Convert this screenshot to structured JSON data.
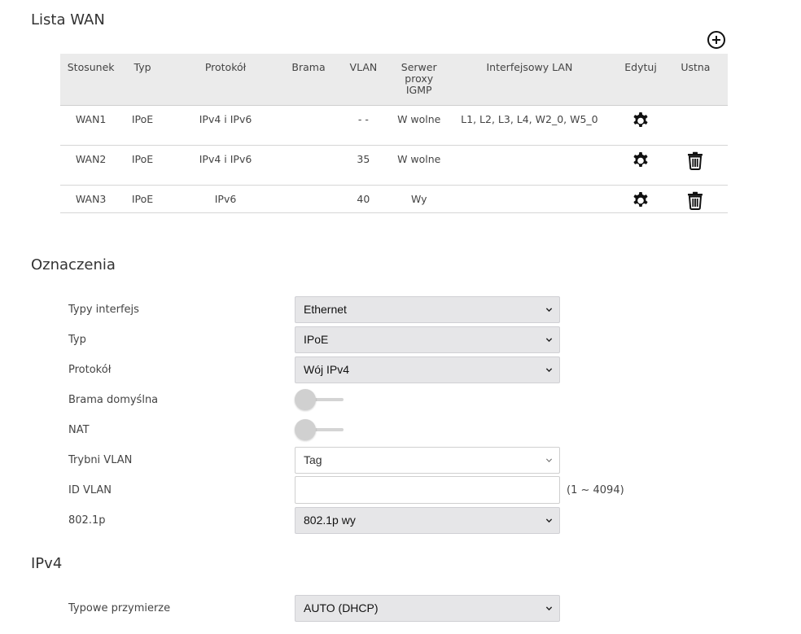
{
  "wan_list": {
    "title": "Lista WAN",
    "headers": [
      "Stosunek",
      "Typ",
      "Protokół",
      "Brama",
      "VLAN",
      "Serwer proxy IGMP",
      "Interfejsowy LAN",
      "Edytuj",
      "Ustna"
    ],
    "rows": [
      {
        "name": "WAN1",
        "type": "IPoE",
        "protocol": "IPv4 i IPv6",
        "gateway": "",
        "vlan": "- -",
        "igmp": "W wolne",
        "lan": "L1, L2, L3, L4, W2_0, W5_0",
        "deletable": false
      },
      {
        "name": "WAN2",
        "type": "IPoE",
        "protocol": "IPv4 i IPv6",
        "gateway": "",
        "vlan": "35",
        "igmp": "W wolne",
        "lan": "",
        "deletable": true
      },
      {
        "name": "WAN3",
        "type": "IPoE",
        "protocol": "IPv6",
        "gateway": "",
        "vlan": "40",
        "igmp": "Wy",
        "lan": "",
        "deletable": true
      }
    ]
  },
  "labels": {
    "title": "Oznaczenia",
    "interface_type_label": "Typy interfejs",
    "interface_type_value": "Ethernet",
    "type_label": "Typ",
    "type_value": "IPoE",
    "protocol_label": "Protokół",
    "protocol_value": "Wój IPv4",
    "default_gateway_label": "Brama domyślna",
    "nat_label": "NAT",
    "vlan_mode_label": "Trybni VLAN",
    "vlan_mode_value": "Tag",
    "vlan_id_label": "ID VLAN",
    "vlan_id_value": "",
    "vlan_id_hint": "(1 ~ 4094)",
    "dot1p_label": "802.1p",
    "dot1p_value": "802.1p wy"
  },
  "ipv4": {
    "title": "IPv4",
    "connection_type_label": "Typowe przymierze",
    "connection_type_value": "AUTO (DHCP)"
  }
}
